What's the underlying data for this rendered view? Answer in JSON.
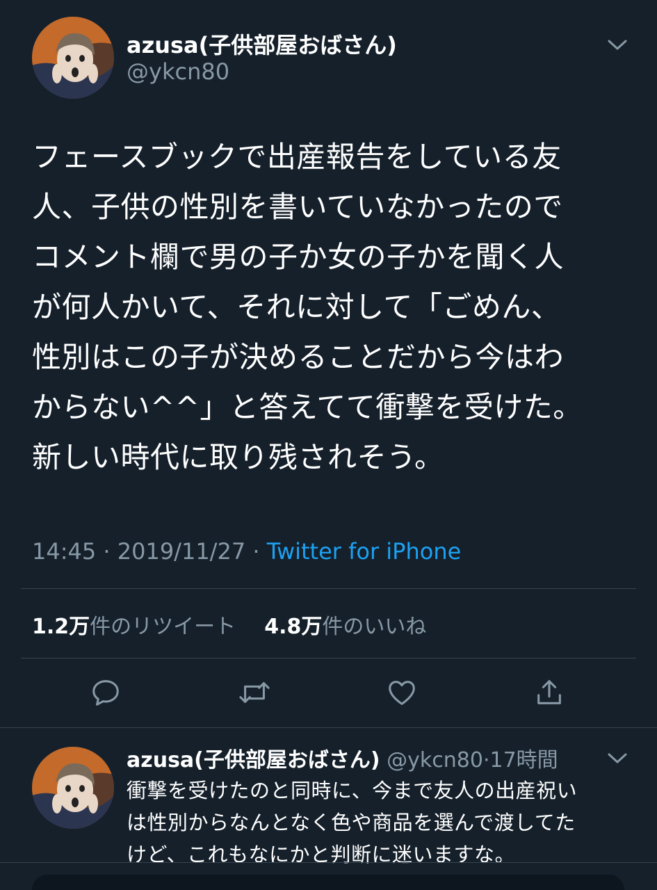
{
  "main_tweet": {
    "display_name": "azusa(子供部屋おばさん)",
    "handle": "@ykcn80",
    "text": "フェースブックで出産報告をしている友\n人、子供の性別を書いていなかったので\nコメント欄で男の子か女の子かを聞く人\nが何人かいて、それに対して「ごめん、\n性別はこの子が決めることだから今はわ\nからない^^」と答えてて衝撃を受けた。\n新しい時代に取り残されそう。",
    "time": "14:45",
    "date": "2019/11/27",
    "separator": " · ",
    "source": "Twitter for iPhone",
    "retweet_count": "1.2万",
    "retweet_label": "件のリツイート",
    "like_count": "4.8万",
    "like_label": "件のいいね"
  },
  "actions": [
    {
      "icon": "reply-icon"
    },
    {
      "icon": "retweet-icon"
    },
    {
      "icon": "like-icon"
    },
    {
      "icon": "share-icon"
    }
  ],
  "reply_tweet": {
    "display_name": "azusa(子供部屋おばさん)",
    "handle": "@ykcn80",
    "separator": "·",
    "time_ago": "17時間",
    "text": "衝撃を受けたのと同時に、今まで友人の出産祝い\nは性別からなんとなく色や商品を選んで渡してた\nけど、これもなにかと判断に迷いますな。"
  },
  "colors": {
    "background": "#15202b",
    "text": "#ffffff",
    "secondary": "#8899a6",
    "accent": "#1da1f2",
    "divider": "#38444d"
  }
}
